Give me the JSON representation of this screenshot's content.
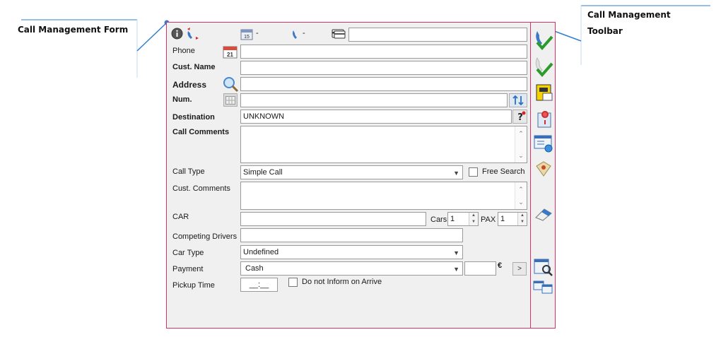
{
  "callouts": {
    "form_label": "Call Management Form",
    "toolbar_label_line1": "Call Management",
    "toolbar_label_line2": "Toolbar"
  },
  "header": {
    "dash1": "-",
    "dash2": "-",
    "top_field_value": ""
  },
  "form": {
    "phone_label": "Phone",
    "phone_value": "",
    "calendar_day": "21",
    "header_calendar_day": "15",
    "cust_name_label": "Cust. Name",
    "cust_name_value": "",
    "address_label": "Address",
    "address_value": "",
    "num_label": "Num.",
    "num_value": "",
    "destination_label": "Destination",
    "destination_value": "UNKNOWN",
    "call_comments_label": "Call Comments",
    "call_comments_value": "",
    "call_type_label": "Call Type",
    "call_type_value": "Simple Call",
    "free_search_label": "Free Search",
    "cust_comments_label": "Cust. Comments",
    "cust_comments_value": "",
    "car_label": "CAR",
    "car_value": "",
    "cars_label": "Cars",
    "cars_value": "1",
    "pax_label": "PAX",
    "pax_value": "1",
    "competing_drivers_label": "Competing Drivers",
    "competing_drivers_value": "",
    "car_type_label": "Car Type",
    "car_type_value": "Undefined",
    "payment_label": "Payment",
    "payment_value": "Cash",
    "amount_value": "",
    "currency": "€",
    "go_button": ">",
    "pickup_time_label": "Pickup Time",
    "pickup_time_value": "__:__",
    "no_inform_label": "Do not Inform on Arrive"
  },
  "colors": {
    "frame_border": "#d8306a",
    "callout_line": "#2f7fd0",
    "panel_bg": "#f0f0f0"
  }
}
